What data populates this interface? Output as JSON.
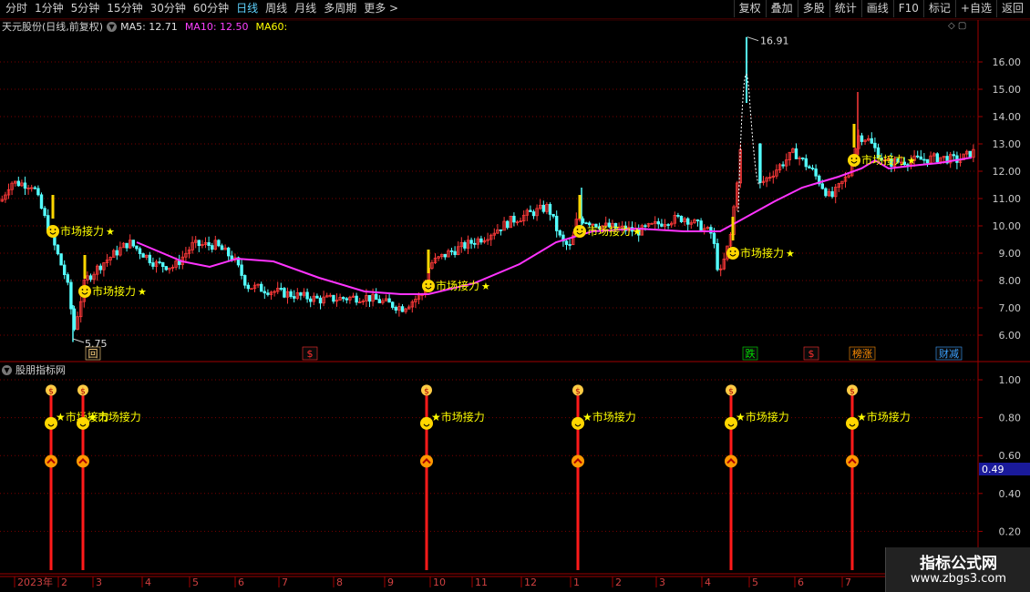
{
  "toolbar": {
    "periods": [
      "分时",
      "1分钟",
      "5分钟",
      "15分钟",
      "30分钟",
      "60分钟",
      "日线",
      "周线",
      "月线",
      "多周期",
      "更多 >"
    ],
    "active_index": 6,
    "buttons": [
      "复权",
      "叠加",
      "多股",
      "统计",
      "画线",
      "F10",
      "标记",
      "+自选",
      "返回"
    ]
  },
  "header": {
    "stock": "天元股份(日线,前复权)",
    "ma5": "MA5: 12.71",
    "ma10": "MA10: 12.50",
    "ma60": "MA60:"
  },
  "subchart": {
    "title": "股朋指标网",
    "current_value": "0.49"
  },
  "main_axis_labels": [
    "16.00",
    "15.00",
    "14.00",
    "13.00",
    "12.00",
    "11.00",
    "10.00",
    "9.00",
    "8.00",
    "7.00",
    "6.00"
  ],
  "sub_axis_labels": [
    "1.00",
    "0.80",
    "0.60",
    "0.40",
    "0.20"
  ],
  "x_labels": [
    "2023年",
    "2",
    "3",
    "4",
    "5",
    "6",
    "7",
    "8",
    "9",
    "10",
    "11",
    "12",
    "1",
    "2",
    "3",
    "4",
    "5",
    "6",
    "7"
  ],
  "annotations": {
    "high": "16.91",
    "low": "5.75",
    "signal": "市场接力",
    "star": "★",
    "signal_sub": "★市场接力"
  },
  "event_markers": [
    {
      "label": "回",
      "color": "#ffd27f"
    },
    {
      "label": "$",
      "color": "#ff3030"
    },
    {
      "label": "跌",
      "color": "#00e000"
    },
    {
      "label": "$",
      "color": "#ff3030"
    },
    {
      "label": "榜涨",
      "color": "#ff8c00"
    },
    {
      "label": "财减",
      "color": "#3aa0ff"
    }
  ],
  "watermark": {
    "title": "指标公式网",
    "url": "www.zbgs3.com"
  },
  "colors": {
    "up": "#ff3a3a",
    "down": "#54ffff",
    "ma": "#ff33ff",
    "signal": "#ffd700",
    "grid": "#7a0000",
    "axis": "#a00000"
  },
  "chart_data": {
    "type": "candlestick",
    "main": {
      "ylim": [
        5.5,
        17.0
      ],
      "price_path": [
        [
          0,
          10.9
        ],
        [
          10,
          11.6
        ],
        [
          35,
          11.5
        ],
        [
          55,
          9.6
        ],
        [
          72,
          8.0
        ],
        [
          80,
          6.2
        ],
        [
          92,
          8.0
        ],
        [
          110,
          8.6
        ],
        [
          140,
          9.4
        ],
        [
          170,
          8.6
        ],
        [
          190,
          8.5
        ],
        [
          210,
          9.3
        ],
        [
          235,
          9.3
        ],
        [
          255,
          8.8
        ],
        [
          270,
          7.8
        ],
        [
          300,
          7.6
        ],
        [
          350,
          7.3
        ],
        [
          400,
          7.4
        ],
        [
          440,
          7.0
        ],
        [
          462,
          7.5
        ],
        [
          470,
          8.6
        ],
        [
          490,
          9.0
        ],
        [
          530,
          9.6
        ],
        [
          560,
          10.2
        ],
        [
          600,
          10.7
        ],
        [
          615,
          9.4
        ],
        [
          625,
          9.2
        ],
        [
          632,
          10.3
        ],
        [
          660,
          10.0
        ],
        [
          700,
          9.8
        ],
        [
          730,
          10.2
        ],
        [
          750,
          10.3
        ],
        [
          780,
          9.7
        ],
        [
          788,
          8.1
        ],
        [
          800,
          9.6
        ],
        [
          812,
          13.0
        ],
        [
          817,
          16.3
        ],
        [
          825,
          15.0
        ],
        [
          832,
          11.5
        ],
        [
          845,
          11.9
        ],
        [
          870,
          12.7
        ],
        [
          890,
          12.0
        ],
        [
          910,
          11.0
        ],
        [
          930,
          11.9
        ],
        [
          940,
          13.3
        ],
        [
          950,
          13.2
        ],
        [
          970,
          12.3
        ],
        [
          1000,
          12.4
        ],
        [
          1030,
          12.5
        ],
        [
          1050,
          12.4
        ],
        [
          1066,
          12.7
        ]
      ],
      "ma_line": [
        [
          150,
          9.4
        ],
        [
          200,
          8.7
        ],
        [
          230,
          8.5
        ],
        [
          260,
          8.8
        ],
        [
          300,
          8.7
        ],
        [
          350,
          8.1
        ],
        [
          400,
          7.6
        ],
        [
          440,
          7.5
        ],
        [
          470,
          7.5
        ],
        [
          520,
          7.9
        ],
        [
          570,
          8.6
        ],
        [
          610,
          9.4
        ],
        [
          650,
          9.8
        ],
        [
          700,
          9.9
        ],
        [
          750,
          9.8
        ],
        [
          790,
          9.8
        ],
        [
          812,
          10.2
        ],
        [
          850,
          10.9
        ],
        [
          880,
          11.4
        ],
        [
          920,
          11.8
        ],
        [
          945,
          12.1
        ],
        [
          960,
          12.4
        ],
        [
          975,
          12.1
        ],
        [
          1000,
          12.2
        ],
        [
          1030,
          12.3
        ],
        [
          1066,
          12.5
        ]
      ]
    },
    "signals": [
      {
        "x": 58,
        "price": 9.8
      },
      {
        "x": 93,
        "price": 7.6
      },
      {
        "x": 470,
        "price": 7.8
      },
      {
        "x": 636,
        "price": 9.8
      },
      {
        "x": 804,
        "price": 9.0
      },
      {
        "x": 937,
        "price": 12.4
      }
    ],
    "sub": {
      "ylim": [
        0.0,
        1.1
      ],
      "signal_value": 1.0,
      "levels": [
        0.96,
        0.77,
        0.57
      ]
    }
  }
}
